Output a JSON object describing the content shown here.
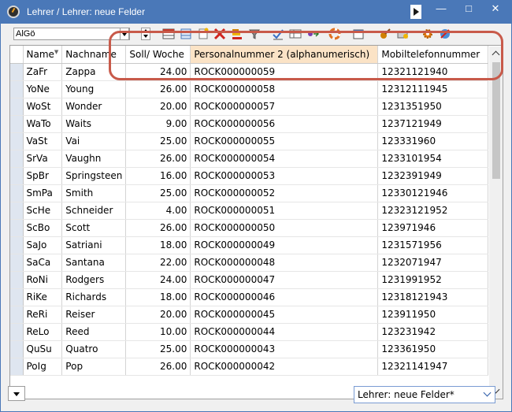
{
  "window": {
    "title": "Lehrer / Lehrer: neue Felder"
  },
  "toolbar": {
    "filter_value": "AlGö"
  },
  "table": {
    "columns": [
      "Name",
      "Nachname",
      "Soll/ Woche",
      "Personalnummer 2 (alphanumerisch)",
      "Mobiltelefonnummer"
    ],
    "rows": [
      [
        "ZaFr",
        "Zappa",
        "24.00",
        "ROCK000000059",
        "12321121940"
      ],
      [
        "YoNe",
        "Young",
        "26.00",
        "ROCK000000058",
        "12312111945"
      ],
      [
        "WoSt",
        "Wonder",
        "20.00",
        "ROCK000000057",
        "1231351950"
      ],
      [
        "WaTo",
        "Waits",
        "9.00",
        "ROCK000000056",
        "1237121949"
      ],
      [
        "VaSt",
        "Vai",
        "25.00",
        "ROCK000000055",
        "123331960"
      ],
      [
        "SrVa",
        "Vaughn",
        "26.00",
        "ROCK000000054",
        "1233101954"
      ],
      [
        "SpBr",
        "Springsteen",
        "16.00",
        "ROCK000000053",
        "1232391949"
      ],
      [
        "SmPa",
        "Smith",
        "25.00",
        "ROCK000000052",
        "12330121946"
      ],
      [
        "ScHe",
        "Schneider",
        "4.00",
        "ROCK000000051",
        "12323121952"
      ],
      [
        "ScBo",
        "Scott",
        "26.00",
        "ROCK000000050",
        "123971946"
      ],
      [
        "SaJo",
        "Satriani",
        "18.00",
        "ROCK000000049",
        "1231571956"
      ],
      [
        "SaCa",
        "Santana",
        "22.00",
        "ROCK000000048",
        "1232071947"
      ],
      [
        "RoNi",
        "Rodgers",
        "24.00",
        "ROCK000000047",
        "1231991952"
      ],
      [
        "RiKe",
        "Richards",
        "18.00",
        "ROCK000000046",
        "12318121943"
      ],
      [
        "ReRi",
        "Reiser",
        "20.00",
        "ROCK000000045",
        "123911950"
      ],
      [
        "ReLo",
        "Reed",
        "10.00",
        "ROCK000000044",
        "123231942"
      ],
      [
        "QuSu",
        "Quatro",
        "25.00",
        "ROCK000000043",
        "123361950"
      ],
      [
        "PoIg",
        "Pop",
        "26.00",
        "ROCK000000042",
        "12321141947"
      ]
    ]
  },
  "footer": {
    "view_select": "Lehrer: neue Felder*"
  },
  "colors": {
    "titlebar": "#4a78b8",
    "highlight_header": "#fbe3c6",
    "annotation": "#c85a4a"
  }
}
